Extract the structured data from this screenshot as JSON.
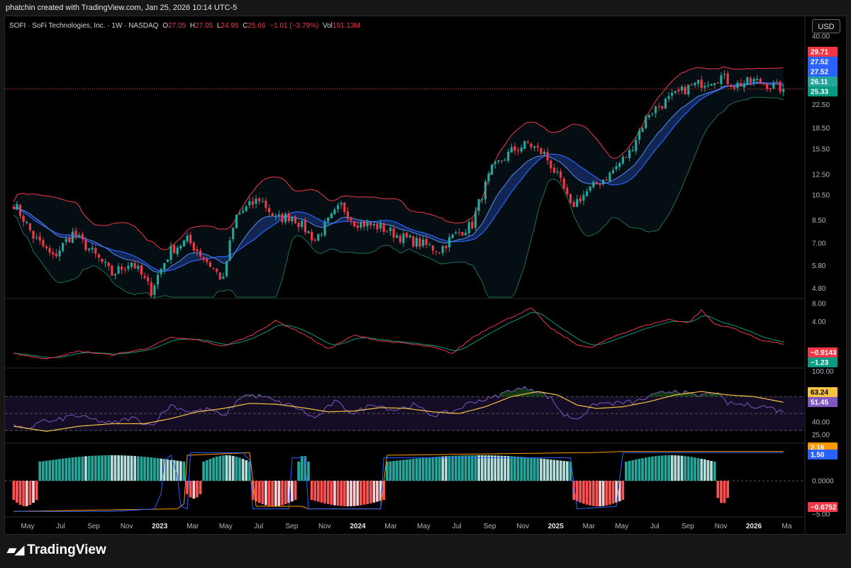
{
  "header": {
    "credit": "phatchin created with TradingView.com, Jan 25, 2026 10:14 UTC-5"
  },
  "legend": {
    "symbol": "SOFI · SoFi Technologies, Inc. · 1W · NASDAQ",
    "o_label": "O",
    "o_value": "27.05",
    "h_label": "H",
    "h_value": "27.05",
    "l_label": "L",
    "l_value": "24.95",
    "c_label": "C",
    "c_value": "25.66",
    "change": "−1.01 (−3.79%)",
    "vol_label": "Vol",
    "vol_value": "191.13M"
  },
  "currency_button": "USD",
  "brand": "TradingView",
  "colors": {
    "up": "#26a69a",
    "down": "#f23645",
    "ma_blue": "#2962ff",
    "bb_red": "#f23645",
    "bb_green": "#1b6e57",
    "rsi": "#7e57c2",
    "rsi_ma": "#f5c242",
    "hist_up": "#26a69a",
    "hist_up_light": "#b2dfdb",
    "hist_down": "#ff5252",
    "hist_down_light": "#ffcdd2",
    "ind_orange": "#ff9800"
  },
  "chart_data": {
    "type": "candlestick",
    "symbol": "SOFI",
    "interval": "1W",
    "x_axis_labels": [
      "May",
      "Jul",
      "Sep",
      "Nov",
      "2023",
      "Mar",
      "May",
      "Jul",
      "Sep",
      "Nov",
      "2024",
      "Mar",
      "May",
      "Jul",
      "Sep",
      "Nov",
      "2025",
      "Mar",
      "May",
      "Jul",
      "Sep",
      "Nov",
      "2026",
      "Ma"
    ],
    "price_panel": {
      "scale": "log",
      "y_ticks": [
        "40.00",
        "27.50",
        "22.50",
        "18.50",
        "15.50",
        "12.50",
        "10.50",
        "8.50",
        "7.00",
        "5.80",
        "4.80"
      ],
      "price_labels": [
        {
          "value": "29.71",
          "color": "#f23645"
        },
        {
          "value": "27.52",
          "color": "#2962ff"
        },
        {
          "value": "27.52",
          "color": "#2962ff"
        },
        {
          "value": "26.11",
          "color": "#26a69a"
        },
        {
          "value": "25.33",
          "color": "#089981"
        }
      ],
      "last_close": 25.66,
      "weekly_close_anchors": [
        [
          0,
          9.8
        ],
        [
          6,
          7.4
        ],
        [
          12,
          6.2
        ],
        [
          18,
          7.6
        ],
        [
          24,
          6.5
        ],
        [
          30,
          5.4
        ],
        [
          36,
          6.0
        ],
        [
          42,
          4.7
        ],
        [
          48,
          6.6
        ],
        [
          53,
          7.2
        ],
        [
          58,
          6.2
        ],
        [
          64,
          5.1
        ],
        [
          68,
          8.8
        ],
        [
          75,
          10.2
        ],
        [
          80,
          8.6
        ],
        [
          85,
          8.8
        ],
        [
          92,
          7.2
        ],
        [
          100,
          9.6
        ],
        [
          104,
          8.4
        ],
        [
          112,
          8.0
        ],
        [
          118,
          7.4
        ],
        [
          124,
          7.0
        ],
        [
          130,
          6.6
        ],
        [
          134,
          7.4
        ],
        [
          140,
          8.2
        ],
        [
          146,
          13.0
        ],
        [
          152,
          15.2
        ],
        [
          157,
          16.2
        ],
        [
          162,
          14.8
        ],
        [
          168,
          11.0
        ],
        [
          170,
          9.5
        ],
        [
          175,
          10.8
        ],
        [
          182,
          12.5
        ],
        [
          188,
          15.0
        ],
        [
          194,
          21.0
        ],
        [
          200,
          23.5
        ],
        [
          206,
          26.0
        ],
        [
          212,
          27.5
        ],
        [
          216,
          28.5
        ],
        [
          220,
          26.5
        ],
        [
          226,
          27.5
        ],
        [
          231,
          26.5
        ],
        [
          235,
          25.66
        ]
      ]
    },
    "macd_panel": {
      "y_ticks": [
        "8.00",
        "4.00",
        "−4.00"
      ],
      "value_labels": [
        {
          "value": "−0.9143",
          "color": "#f23645"
        },
        {
          "value": "−1.23",
          "color": "#089981"
        }
      ],
      "line_anchors": [
        [
          0,
          -3.0
        ],
        [
          10,
          -4.2
        ],
        [
          20,
          -2.5
        ],
        [
          30,
          -3.3
        ],
        [
          40,
          -2.0
        ],
        [
          48,
          0.5
        ],
        [
          56,
          0.0
        ],
        [
          64,
          -1.4
        ],
        [
          72,
          0.8
        ],
        [
          80,
          4.2
        ],
        [
          88,
          1.5
        ],
        [
          96,
          -2.0
        ],
        [
          104,
          1.0
        ],
        [
          112,
          -0.2
        ],
        [
          120,
          -0.8
        ],
        [
          128,
          -1.6
        ],
        [
          134,
          -3.0
        ],
        [
          140,
          0.5
        ],
        [
          146,
          3.0
        ],
        [
          152,
          5.0
        ],
        [
          158,
          7.0
        ],
        [
          164,
          2.5
        ],
        [
          172,
          -1.0
        ],
        [
          176,
          -1.8
        ],
        [
          184,
          1.0
        ],
        [
          192,
          3.0
        ],
        [
          200,
          4.5
        ],
        [
          206,
          3.8
        ],
        [
          210,
          6.5
        ],
        [
          214,
          3.5
        ],
        [
          220,
          2.5
        ],
        [
          228,
          0.0
        ],
        [
          235,
          -0.9
        ]
      ]
    },
    "rsi_panel": {
      "y_ticks": [
        "100.00",
        "40.00",
        "25.00"
      ],
      "value_labels": [
        {
          "value": "63.24",
          "color": "#f5c242"
        },
        {
          "value": "51.45",
          "color": "#7e57c2"
        }
      ],
      "bands": [
        30,
        70
      ],
      "rsi_anchors": [
        [
          0,
          35
        ],
        [
          4,
          30
        ],
        [
          8,
          42
        ],
        [
          12,
          40
        ],
        [
          18,
          48
        ],
        [
          24,
          43
        ],
        [
          30,
          38
        ],
        [
          36,
          45
        ],
        [
          42,
          36
        ],
        [
          48,
          60
        ],
        [
          54,
          52
        ],
        [
          60,
          55
        ],
        [
          64,
          46
        ],
        [
          70,
          72
        ],
        [
          76,
          70
        ],
        [
          80,
          64
        ],
        [
          86,
          58
        ],
        [
          92,
          44
        ],
        [
          98,
          64
        ],
        [
          104,
          50
        ],
        [
          110,
          62
        ],
        [
          116,
          54
        ],
        [
          122,
          60
        ],
        [
          128,
          48
        ],
        [
          134,
          52
        ],
        [
          140,
          64
        ],
        [
          146,
          68
        ],
        [
          152,
          78
        ],
        [
          158,
          80
        ],
        [
          164,
          68
        ],
        [
          168,
          48
        ],
        [
          172,
          44
        ],
        [
          178,
          62
        ],
        [
          184,
          62
        ],
        [
          190,
          64
        ],
        [
          196,
          72
        ],
        [
          202,
          78
        ],
        [
          208,
          70
        ],
        [
          214,
          75
        ],
        [
          218,
          62
        ],
        [
          224,
          60
        ],
        [
          230,
          58
        ],
        [
          235,
          51.45
        ]
      ],
      "rsi_ma_anchors": [
        [
          0,
          35
        ],
        [
          10,
          29
        ],
        [
          20,
          35
        ],
        [
          30,
          38
        ],
        [
          40,
          38
        ],
        [
          48,
          44
        ],
        [
          56,
          52
        ],
        [
          64,
          56
        ],
        [
          72,
          62
        ],
        [
          80,
          61
        ],
        [
          88,
          57
        ],
        [
          96,
          52
        ],
        [
          104,
          53
        ],
        [
          112,
          57
        ],
        [
          120,
          56
        ],
        [
          128,
          52
        ],
        [
          136,
          50
        ],
        [
          144,
          58
        ],
        [
          152,
          70
        ],
        [
          160,
          76
        ],
        [
          166,
          72
        ],
        [
          172,
          60
        ],
        [
          178,
          56
        ],
        [
          186,
          58
        ],
        [
          194,
          64
        ],
        [
          202,
          72
        ],
        [
          210,
          76
        ],
        [
          218,
          72
        ],
        [
          226,
          70
        ],
        [
          235,
          63.24
        ]
      ]
    },
    "lower_panel": {
      "y_ticks": [
        "2.16",
        "0.0000",
        "−5.00"
      ],
      "value_labels": [
        {
          "value": "2.16",
          "color": "#ff9800"
        },
        {
          "value": "1.50",
          "color": "#2962ff"
        },
        {
          "value": "−0.6752",
          "color": "#f23645"
        }
      ],
      "histogram_segments": [
        {
          "from": 0,
          "to": 7,
          "value": -1.0
        },
        {
          "from": 8,
          "to": 52,
          "value": 1.0
        },
        {
          "from": 53,
          "to": 57,
          "value": -0.7
        },
        {
          "from": 58,
          "to": 72,
          "value": 1.0
        },
        {
          "from": 73,
          "to": 86,
          "value": -1.0
        },
        {
          "from": 87,
          "to": 90,
          "value": 1.0
        },
        {
          "from": 91,
          "to": 113,
          "value": -1.0
        },
        {
          "from": 114,
          "to": 170,
          "value": 1.0
        },
        {
          "from": 171,
          "to": 186,
          "value": -1.0
        },
        {
          "from": 187,
          "to": 214,
          "value": 1.0
        },
        {
          "from": 215,
          "to": 218,
          "value": -0.9
        }
      ],
      "blue_line_anchors": [
        [
          0,
          -1.2
        ],
        [
          30,
          -1.2
        ],
        [
          43,
          -1.1
        ],
        [
          45,
          -0.5
        ],
        [
          46,
          0.8
        ],
        [
          48,
          1.0
        ],
        [
          50,
          0.2
        ],
        [
          51,
          -1.0
        ],
        [
          53,
          -1.1
        ],
        [
          54,
          1.1
        ],
        [
          70,
          1.1
        ],
        [
          72,
          0.8
        ],
        [
          73,
          -1.1
        ],
        [
          84,
          -1.1
        ],
        [
          85,
          0.9
        ],
        [
          89,
          0.9
        ],
        [
          90,
          -1.1
        ],
        [
          112,
          -1.1
        ],
        [
          113,
          0.9
        ],
        [
          170,
          0.9
        ],
        [
          172,
          -1.1
        ],
        [
          184,
          -1.0
        ],
        [
          186,
          1.1
        ],
        [
          235,
          1.1
        ]
      ],
      "orange_line_anchors": [
        [
          0,
          -1.2
        ],
        [
          50,
          -1.1
        ],
        [
          52,
          -0.9
        ],
        [
          53,
          1.0
        ],
        [
          72,
          1.1
        ],
        [
          74,
          -1.0
        ],
        [
          88,
          -1.0
        ],
        [
          90,
          -1.1
        ],
        [
          112,
          -1.1
        ],
        [
          114,
          1.0
        ],
        [
          172,
          1.1
        ],
        [
          176,
          1.1
        ],
        [
          186,
          1.15
        ],
        [
          235,
          1.15
        ]
      ]
    }
  }
}
